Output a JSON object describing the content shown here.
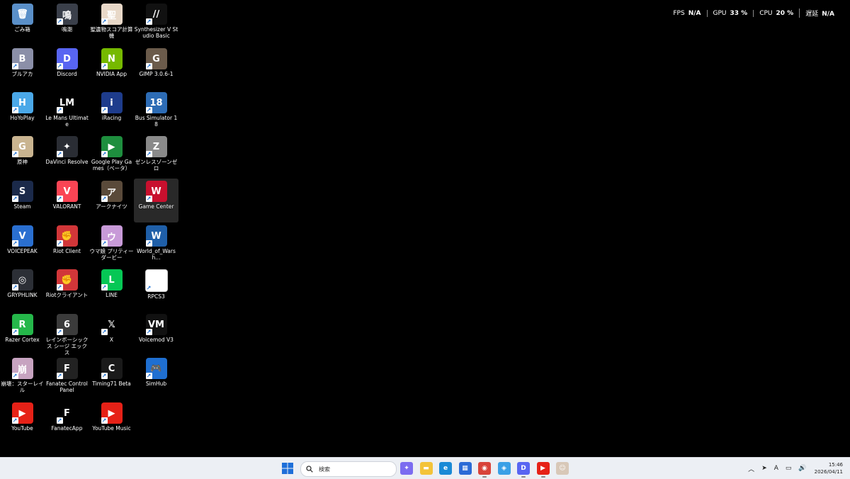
{
  "overlay": {
    "fps_label": "FPS",
    "fps_value": "N/A",
    "gpu_label": "GPU",
    "gpu_value": "33 %",
    "cpu_label": "CPU",
    "cpu_value": "20 %",
    "latency_label": "遅延",
    "latency_value": "N/A"
  },
  "desktop": {
    "icons": [
      {
        "label": "ごみ箱",
        "icon": "recycle-bin-icon",
        "color": "#5a8fc8",
        "glyph": "🗑"
      },
      {
        "label": "ブルアカ",
        "icon": "blue-archive-icon",
        "color": "#8b8fa8",
        "glyph": "B"
      },
      {
        "label": "HoYoPlay",
        "icon": "hoyoplay-icon",
        "color": "#4aa8e8",
        "glyph": "H"
      },
      {
        "label": "原神",
        "icon": "genshin-icon",
        "color": "#c9b490",
        "glyph": "G"
      },
      {
        "label": "Steam",
        "icon": "steam-icon",
        "color": "#1b2a4a",
        "glyph": "S"
      },
      {
        "label": "VOICEPEAK",
        "icon": "voicepeak-icon",
        "color": "#2a6fd0",
        "glyph": "V"
      },
      {
        "label": "GRYPHLINK",
        "icon": "gryphlink-icon",
        "color": "#2c2f36",
        "glyph": "◎"
      },
      {
        "label": "Razer Cortex",
        "icon": "razer-cortex-icon",
        "color": "#25b74a",
        "glyph": "R"
      },
      {
        "label": "崩壊：スターレイル",
        "icon": "star-rail-icon",
        "color": "#c7a3c0",
        "glyph": "崩"
      },
      {
        "label": "YouTube",
        "icon": "youtube-icon",
        "color": "#e62117",
        "glyph": "▶"
      },
      {
        "label": "鳴潮",
        "icon": "wuthering-waves-icon",
        "color": "#3a3f4a",
        "glyph": "鳴"
      },
      {
        "label": "Discord",
        "icon": "discord-icon",
        "color": "#5865f2",
        "glyph": "D"
      },
      {
        "label": "Le Mans Ultimate",
        "icon": "le-mans-ultimate-icon",
        "color": "#000000",
        "glyph": "LM"
      },
      {
        "label": "DaVinci Resolve",
        "icon": "davinci-resolve-icon",
        "color": "#2a2d34",
        "glyph": "✦"
      },
      {
        "label": "VALORANT",
        "icon": "valorant-icon",
        "color": "#fa4454",
        "glyph": "V"
      },
      {
        "label": "Riot Client",
        "icon": "riot-client-icon",
        "color": "#d13639",
        "glyph": "✊"
      },
      {
        "label": "Riotクライアント",
        "icon": "riot-client-jp-icon",
        "color": "#d13639",
        "glyph": "✊"
      },
      {
        "label": "レインボーシックス シージ エックス",
        "icon": "rainbow-six-icon",
        "color": "#3b3b3b",
        "glyph": "6"
      },
      {
        "label": "Fanatec Control Panel",
        "icon": "fanatec-control-panel-icon",
        "color": "#222222",
        "glyph": "F"
      },
      {
        "label": "FanatecApp",
        "icon": "fanatec-app-icon",
        "color": "#000000",
        "glyph": "F"
      },
      {
        "label": "聖遺物スコア計算機",
        "icon": "artifact-score-icon",
        "color": "#e8d8c8",
        "glyph": "聖"
      },
      {
        "label": "NVIDIA App",
        "icon": "nvidia-app-icon",
        "color": "#76b900",
        "glyph": "N"
      },
      {
        "label": "iRacing",
        "icon": "iracing-icon",
        "color": "#1e3c8c",
        "glyph": "i"
      },
      {
        "label": "Google Play Games（ベータ）",
        "icon": "google-play-games-icon",
        "color": "#1e8e3e",
        "glyph": "▶"
      },
      {
        "label": "アークナイツ",
        "icon": "arknights-icon",
        "color": "#5a4a3a",
        "glyph": "ア"
      },
      {
        "label": "ウマ娘 プリティーダービー",
        "icon": "umamusume-icon",
        "color": "#c89ad8",
        "glyph": "ウ"
      },
      {
        "label": "LINE",
        "icon": "line-icon",
        "color": "#06c755",
        "glyph": "L"
      },
      {
        "label": "X",
        "icon": "x-icon",
        "color": "#000000",
        "glyph": "𝕏"
      },
      {
        "label": "Timing71 Beta",
        "icon": "timing71-icon",
        "color": "#1a1a1a",
        "glyph": "C"
      },
      {
        "label": "YouTube Music",
        "icon": "youtube-music-icon",
        "color": "#e62117",
        "glyph": "▶"
      },
      {
        "label": "Synthesizer V Studio Basic",
        "icon": "synthesizer-v-icon",
        "color": "#111111",
        "glyph": "//"
      },
      {
        "label": "GIMP 3.0.6-1",
        "icon": "gimp-icon",
        "color": "#6b5b4b",
        "glyph": "G"
      },
      {
        "label": "Bus Simulator 18",
        "icon": "bus-simulator-icon",
        "color": "#2d6cb5",
        "glyph": "18"
      },
      {
        "label": "ゼンレスゾーンゼロ",
        "icon": "zenless-zone-zero-icon",
        "color": "#8a8a8a",
        "glyph": "Z"
      },
      {
        "label": "Game Center",
        "icon": "game-center-icon",
        "color": "#c8102e",
        "glyph": "W",
        "selected": true
      },
      {
        "label": "World_of_Warsh...",
        "icon": "world-of-warships-icon",
        "color": "#1f5fa8",
        "glyph": "W"
      },
      {
        "label": "RPCS3",
        "icon": "rpcs3-icon",
        "color": "#ffffff",
        "glyph": ""
      },
      {
        "label": "Voicemod V3",
        "icon": "voicemod-icon",
        "color": "#111111",
        "glyph": "VM"
      },
      {
        "label": "SimHub",
        "icon": "simhub-icon",
        "color": "#1f6fd1",
        "glyph": "🎮"
      }
    ]
  },
  "taskbar": {
    "search_placeholder": "検索",
    "apps": [
      {
        "name": "copilot",
        "icon": "copilot-icon",
        "color": "#7b6cf0",
        "glyph": "✦"
      },
      {
        "name": "file-explorer",
        "icon": "file-explorer-icon",
        "color": "#f3c339",
        "glyph": "▬"
      },
      {
        "name": "edge",
        "icon": "edge-icon",
        "color": "#1a8ad6",
        "glyph": "e"
      },
      {
        "name": "store",
        "icon": "microsoft-store-icon",
        "color": "#2b6bd6",
        "glyph": "▦"
      },
      {
        "name": "chrome",
        "icon": "chrome-icon",
        "color": "#d8433a",
        "glyph": "◉"
      },
      {
        "name": "app-blue",
        "icon": "app-blue-icon",
        "color": "#3aa0e6",
        "glyph": "◈"
      },
      {
        "name": "discord",
        "icon": "discord-icon",
        "color": "#5865f2",
        "glyph": "D"
      },
      {
        "name": "youtube",
        "icon": "youtube-icon",
        "color": "#e62117",
        "glyph": "▶"
      },
      {
        "name": "game",
        "icon": "game-avatar-icon",
        "color": "#d8c8b8",
        "glyph": "☺"
      }
    ],
    "clock_time": "15:46",
    "clock_date": "2026/04/11",
    "ime": "A"
  }
}
